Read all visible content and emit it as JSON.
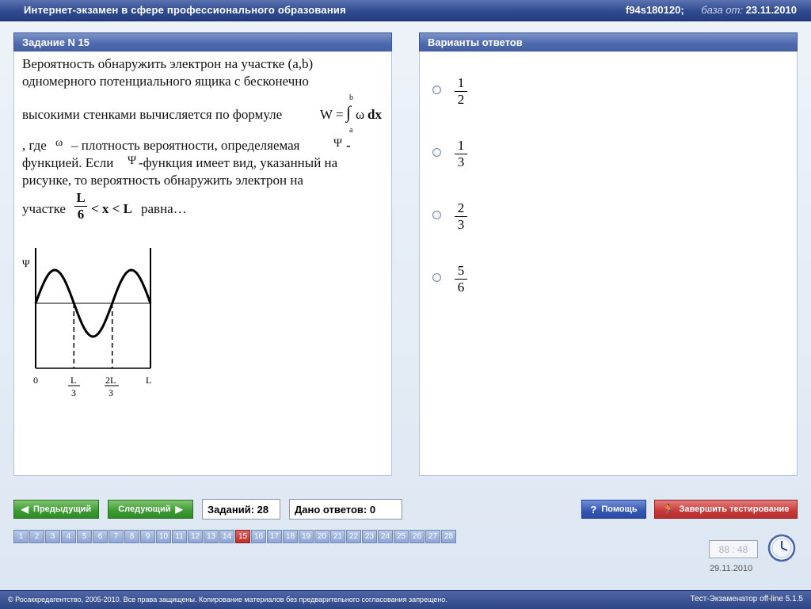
{
  "header": {
    "title": "Интернет-экзамен в сфере профессионального образования",
    "session_id": "f94s180120;",
    "base_label": "база от:",
    "base_date": "23.11.2010"
  },
  "task": {
    "title": "Задание N 15",
    "line1": "Вероятность обнаружить электрон на участке (a,b)",
    "line2": "одномерного потенциального ящика с бесконечно",
    "line3": "высокими стенками вычисляется по формуле",
    "formula_w": "W =",
    "formula_upper": "b",
    "formula_lower": "a",
    "formula_integrand": "ω",
    "formula_dx": "dx",
    "line4_a": ", где",
    "line4_omega": "ω",
    "line4_b": "– плотность вероятности, определяемая",
    "line4_psi": "Ψ",
    "line4_dash": "-",
    "line5_a": "функцией. Если",
    "line5_psi": "Ψ",
    "line5_b": "-функция имеет вид, указанный на",
    "line6": "рисунке, то вероятность обнаружить электрон на",
    "line7_a": "участке",
    "frac_num": "L",
    "frac_den": "6",
    "line7_mid": "< x < L",
    "line7_b": "равна…",
    "graph": {
      "y_label": "Ψ",
      "origin": "0",
      "end": "L",
      "tick1_num": "L",
      "tick1_den": "3",
      "tick2_num": "2L",
      "tick2_den": "3"
    }
  },
  "answers": {
    "title": "Варианты ответов",
    "options": [
      {
        "num": "1",
        "den": "2"
      },
      {
        "num": "1",
        "den": "3"
      },
      {
        "num": "2",
        "den": "3"
      },
      {
        "num": "5",
        "den": "6"
      }
    ]
  },
  "nav": {
    "prev_label": "Предыдущий",
    "next_label": "Следующий",
    "tasks_label": "Заданий: 28",
    "answered_label": "Дано ответов: 0",
    "help_label": "Помощь",
    "finish_label": "Завершить тестирование",
    "pages": [
      "1",
      "2",
      "3",
      "4",
      "5",
      "6",
      "7",
      "8",
      "9",
      "10",
      "11",
      "12",
      "13",
      "14",
      "15",
      "16",
      "17",
      "18",
      "19",
      "20",
      "21",
      "22",
      "23",
      "24",
      "25",
      "26",
      "27",
      "28"
    ],
    "active_page": "15"
  },
  "timer": {
    "value": "88 : 48",
    "date": "29.11.2010"
  },
  "footer": {
    "copyright": "© Росаккредагентство, 2005-2010. Все права защищены. Копирование материалов без предварительного согласования запрещено.",
    "version": "Тест-Экзаменатор off-line 5.1.5"
  },
  "colors": {
    "header_bg": "#2f4a8f",
    "nav_green": "#3c9a33",
    "help_blue": "#3556b3",
    "finish_red": "#c93a3a",
    "active_page": "#b92e2e"
  }
}
